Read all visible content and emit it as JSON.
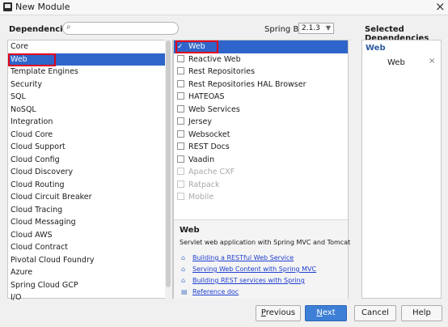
{
  "window": {
    "title": "New Module",
    "close": "×"
  },
  "header": {
    "dependencies_label": "Dependencies",
    "search_icon": "⌕",
    "search_placeholder": "",
    "spring_boot_label": "Spring Boot",
    "spring_boot_version": "2.1.3",
    "selected_label": "Selected Dependencies"
  },
  "categories": [
    "Core",
    "Web",
    "Template Engines",
    "Security",
    "SQL",
    "NoSQL",
    "Integration",
    "Cloud Core",
    "Cloud Support",
    "Cloud Config",
    "Cloud Discovery",
    "Cloud Routing",
    "Cloud Circuit Breaker",
    "Cloud Tracing",
    "Cloud Messaging",
    "Cloud AWS",
    "Cloud Contract",
    "Pivotal Cloud Foundry",
    "Azure",
    "Spring Cloud GCP",
    "I/O"
  ],
  "dependencies": [
    {
      "label": "Web",
      "checked": true,
      "enabled": true
    },
    {
      "label": "Reactive Web",
      "checked": false,
      "enabled": true
    },
    {
      "label": "Rest Repositories",
      "checked": false,
      "enabled": true
    },
    {
      "label": "Rest Repositories HAL Browser",
      "checked": false,
      "enabled": true
    },
    {
      "label": "HATEOAS",
      "checked": false,
      "enabled": true
    },
    {
      "label": "Web Services",
      "checked": false,
      "enabled": true
    },
    {
      "label": "Jersey",
      "checked": false,
      "enabled": true
    },
    {
      "label": "Websocket",
      "checked": false,
      "enabled": true
    },
    {
      "label": "REST Docs",
      "checked": false,
      "enabled": true
    },
    {
      "label": "Vaadin",
      "checked": false,
      "enabled": true
    },
    {
      "label": "Apache CXF",
      "checked": false,
      "enabled": false
    },
    {
      "label": "Ratpack",
      "checked": false,
      "enabled": false
    },
    {
      "label": "Mobile",
      "checked": false,
      "enabled": false
    }
  ],
  "info": {
    "title": "Web",
    "description": "Servlet web application with Spring MVC and Tomcat",
    "links": [
      {
        "icon": "home-icon",
        "label": "Building a RESTful Web Service"
      },
      {
        "icon": "home-icon",
        "label": "Serving Web Content with Spring MVC"
      },
      {
        "icon": "home-icon",
        "label": "Building REST services with Spring"
      },
      {
        "icon": "doc-icon",
        "label": "Reference doc"
      }
    ]
  },
  "selected": {
    "group": "Web",
    "items": [
      {
        "label": "Web",
        "remove": "×"
      }
    ]
  },
  "buttons": {
    "previous_mnemonic": "P",
    "previous_rest": "revious",
    "next_mnemonic": "N",
    "next_rest": "ext",
    "cancel": "Cancel",
    "help": "Help"
  },
  "colors": {
    "selection": "#2f65ca",
    "annotation_box": "#e0001b",
    "link": "#1f3fd0"
  }
}
